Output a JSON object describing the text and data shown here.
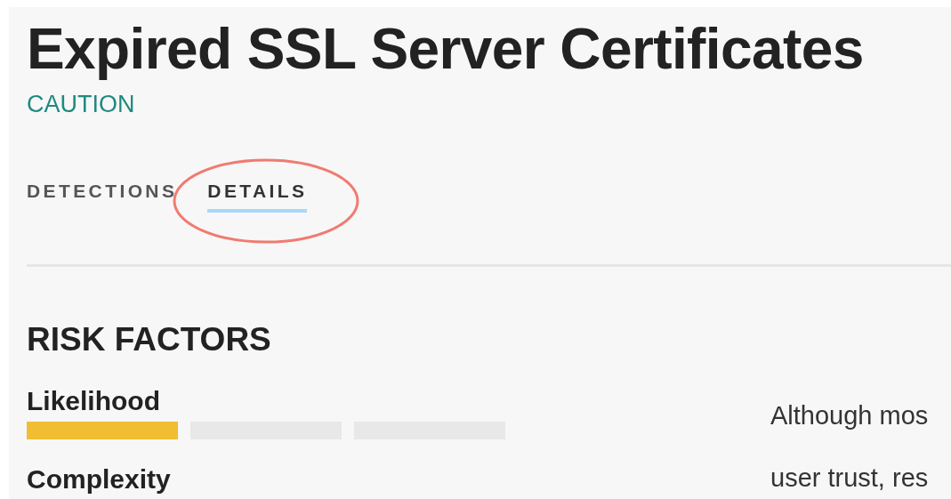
{
  "title": "Expired SSL Server Certificates",
  "severity": "CAUTION",
  "tabs": [
    {
      "label": "DETECTIONS",
      "selected": false,
      "circled": false
    },
    {
      "label": "DETAILS",
      "selected": true,
      "circled": true
    }
  ],
  "section_title": "RISK FACTORS",
  "factors": [
    {
      "label": "Likelihood",
      "level": 0.316
    },
    {
      "label": "Complexity"
    }
  ],
  "description_lines": [
    "Although mos",
    "user trust, res"
  ]
}
